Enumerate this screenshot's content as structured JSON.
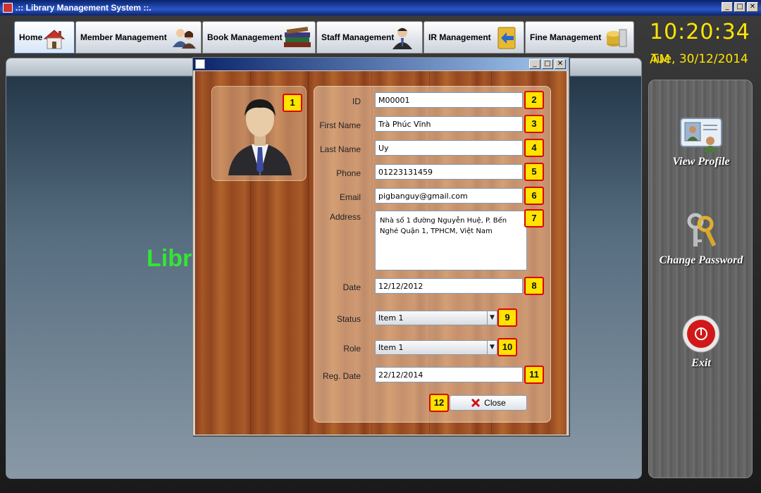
{
  "app": {
    "title": ".:: Library Management System ::."
  },
  "window_controls": {
    "minimize": "_",
    "maximize": "□",
    "close": "✕"
  },
  "tabs": [
    {
      "label": "Home",
      "icon": "house-icon"
    },
    {
      "label": "Member Management",
      "icon": "members-icon"
    },
    {
      "label": "Book Management",
      "icon": "books-icon"
    },
    {
      "label": "Staff Management",
      "icon": "staff-icon"
    },
    {
      "label": "IR Management",
      "icon": "ir-icon"
    },
    {
      "label": "Fine Management",
      "icon": "money-icon"
    }
  ],
  "clock": {
    "time": "10:20:34",
    "ampm": "AM",
    "date": "Tue, 30/12/2014"
  },
  "main": {
    "partial_heading": "Libr"
  },
  "sidebar": {
    "items": [
      {
        "label": "View Profile",
        "icon": "profile-card-icon"
      },
      {
        "label": "Change Password",
        "icon": "keys-icon"
      },
      {
        "label": "Exit",
        "icon": "power-icon"
      }
    ]
  },
  "dialog": {
    "controls": {
      "minimize": "_",
      "maximize": "□",
      "close": "✕"
    },
    "fields": {
      "id": {
        "label": "ID",
        "value": "M00001",
        "badge": "2"
      },
      "first_name": {
        "label": "First Name",
        "value": "Trà Phúc Vĩnh",
        "badge": "3"
      },
      "last_name": {
        "label": "Last Name",
        "value": "Uy",
        "badge": "4"
      },
      "phone": {
        "label": "Phone",
        "value": "01223131459",
        "badge": "5"
      },
      "email": {
        "label": "Email",
        "value": "pigbanguy@gmail.com",
        "badge": "6"
      },
      "address": {
        "label": "Address",
        "value": "Nhà số 1 đường Nguyễn Huệ, P. Bến Nghé Quận 1, TPHCM, Việt Nam",
        "badge": "7"
      },
      "date": {
        "label": "Date",
        "value": "12/12/2012",
        "badge": "8"
      },
      "status": {
        "label": "Status",
        "value": "Item 1",
        "badge": "9"
      },
      "role": {
        "label": "Role",
        "value": "Item 1",
        "badge": "10"
      },
      "reg_date": {
        "label": "Reg. Date",
        "value": "22/12/2014",
        "badge": "11"
      }
    },
    "photo_badge": "1",
    "close": {
      "label": "Close",
      "badge": "12"
    }
  },
  "colors": {
    "clock": "#ffe600",
    "heading": "#33e633",
    "badge_fill": "#ffe400",
    "badge_border": "#e00000"
  }
}
